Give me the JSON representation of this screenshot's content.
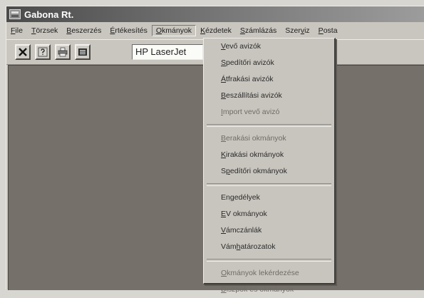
{
  "window": {
    "title": "Gabona Rt."
  },
  "menu": [
    {
      "pre": "",
      "key": "F",
      "post": "ile"
    },
    {
      "pre": "",
      "key": "T",
      "post": "örzsek"
    },
    {
      "pre": "",
      "key": "B",
      "post": "eszerzés"
    },
    {
      "pre": "",
      "key": "É",
      "post": "rtékesítés"
    },
    {
      "pre": "",
      "key": "O",
      "post": "kmányok"
    },
    {
      "pre": "",
      "key": "K",
      "post": "ézdetek"
    },
    {
      "pre": "",
      "key": "S",
      "post": "zámlázás"
    },
    {
      "pre": "Szer",
      "key": "v",
      "post": "iz"
    },
    {
      "pre": "",
      "key": "P",
      "post": "osta"
    }
  ],
  "toolbar": {
    "printer": "HP LaserJet"
  },
  "dropdown": {
    "groups": [
      [
        {
          "pre": "",
          "key": "V",
          "post": "evő avizók"
        },
        {
          "pre": "",
          "key": "S",
          "post": "pedítőri avizók"
        },
        {
          "pre": "",
          "key": "Á",
          "post": "tfrakási avizók"
        },
        {
          "pre": "",
          "key": "B",
          "post": "eszállítási avizók"
        },
        {
          "pre": "",
          "key": "I",
          "post": "mport vevő avizó"
        }
      ],
      [
        {
          "pre": "",
          "key": "B",
          "post": "erakási okmányok"
        },
        {
          "pre": "",
          "key": "K",
          "post": "irakási okmányok"
        },
        {
          "pre": "S",
          "key": "p",
          "post": "edítőri okmányok"
        }
      ],
      [
        {
          "pre": "En",
          "key": "g",
          "post": "edélyek"
        },
        {
          "pre": "",
          "key": "E",
          "post": "V okmányok"
        },
        {
          "pre": "",
          "key": "V",
          "post": "ámczánlák"
        },
        {
          "pre": "Vám",
          "key": "h",
          "post": "atározatok"
        }
      ],
      [
        {
          "pre": "",
          "key": "O",
          "post": "kmányok lekérdezése"
        },
        {
          "pre": "",
          "key": "D",
          "post": "iszpók és okmányok"
        }
      ]
    ]
  },
  "colors": {
    "menu_text": "#1d1d1d",
    "workspace": "#757069",
    "titlebar": "#4b4b4b"
  }
}
